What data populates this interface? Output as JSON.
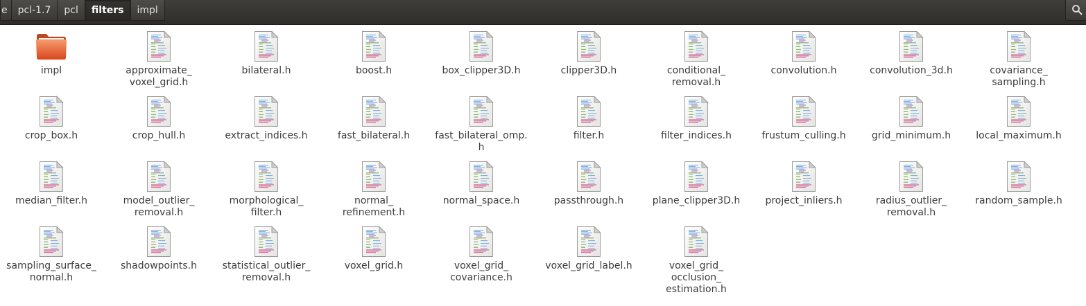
{
  "window": {
    "breadcrumbs": [
      {
        "label": "e"
      },
      {
        "label": "pcl-1.7"
      },
      {
        "label": "pcl"
      },
      {
        "label": "filters",
        "active": true
      },
      {
        "label": "impl"
      }
    ],
    "search_icon": "search-icon"
  },
  "files": [
    {
      "label": "impl",
      "type": "folder"
    },
    {
      "label": "approximate_\nvoxel_grid.h",
      "type": "header"
    },
    {
      "label": "bilateral.h",
      "type": "header"
    },
    {
      "label": "boost.h",
      "type": "header"
    },
    {
      "label": "box_clipper3D.h",
      "type": "header"
    },
    {
      "label": "clipper3D.h",
      "type": "header"
    },
    {
      "label": "conditional_\nremoval.h",
      "type": "header"
    },
    {
      "label": "convolution.h",
      "type": "header"
    },
    {
      "label": "convolution_3d.h",
      "type": "header"
    },
    {
      "label": "covariance_\nsampling.h",
      "type": "header"
    },
    {
      "label": "crop_box.h",
      "type": "header"
    },
    {
      "label": "crop_hull.h",
      "type": "header"
    },
    {
      "label": "extract_indices.h",
      "type": "header"
    },
    {
      "label": "fast_bilateral.h",
      "type": "header"
    },
    {
      "label": "fast_bilateral_omp.\nh",
      "type": "header"
    },
    {
      "label": "filter.h",
      "type": "header"
    },
    {
      "label": "filter_indices.h",
      "type": "header"
    },
    {
      "label": "frustum_culling.h",
      "type": "header"
    },
    {
      "label": "grid_minimum.h",
      "type": "header"
    },
    {
      "label": "local_maximum.h",
      "type": "header"
    },
    {
      "label": "median_filter.h",
      "type": "header"
    },
    {
      "label": "model_outlier_\nremoval.h",
      "type": "header"
    },
    {
      "label": "morphological_\nfilter.h",
      "type": "header"
    },
    {
      "label": "normal_\nrefinement.h",
      "type": "header"
    },
    {
      "label": "normal_space.h",
      "type": "header"
    },
    {
      "label": "passthrough.h",
      "type": "header"
    },
    {
      "label": "plane_clipper3D.h",
      "type": "header"
    },
    {
      "label": "project_inliers.h",
      "type": "header"
    },
    {
      "label": "radius_outlier_\nremoval.h",
      "type": "header"
    },
    {
      "label": "random_sample.h",
      "type": "header"
    },
    {
      "label": "sampling_surface_\nnormal.h",
      "type": "header"
    },
    {
      "label": "shadowpoints.h",
      "type": "header"
    },
    {
      "label": "statistical_outlier_\nremoval.h",
      "type": "header"
    },
    {
      "label": "voxel_grid.h",
      "type": "header"
    },
    {
      "label": "voxel_grid_\ncovariance.h",
      "type": "header"
    },
    {
      "label": "voxel_grid_label.h",
      "type": "header"
    },
    {
      "label": "voxel_grid_\nocclusion_\nestimation.h",
      "type": "header"
    }
  ],
  "colors": {
    "topbar": "#3c3b37",
    "folder": "#e8673a",
    "label_text": "#3c3c3c"
  }
}
